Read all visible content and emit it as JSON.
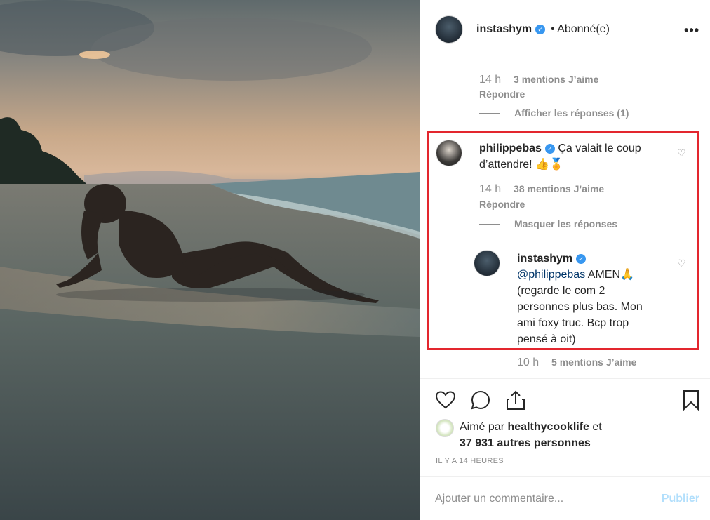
{
  "header": {
    "username": "instashym",
    "separator": "•",
    "follow_status": "Abonné(e)",
    "more_icon": "more-horizontal-icon"
  },
  "comments": [
    {
      "time": "14 h",
      "likes": "3 mentions J’aime",
      "reply": "Répondre",
      "toggle": "Afficher les réponses (1)"
    },
    {
      "username": "philippebas",
      "text_line1": "Ça valait le coup",
      "text_line2": "d’attendre! 👍🏅",
      "time": "14 h",
      "likes": "38 mentions J’aime",
      "reply": "Répondre",
      "toggle": "Masquer les réponses",
      "reply_comment": {
        "username": "instashym",
        "mention": "@philippebas",
        "text": " AMEN🙏",
        "lines": [
          "(regarde le com 2",
          "personnes plus bas. Mon",
          "ami foxy truc. Bcp trop",
          "pensé à oit)"
        ]
      }
    },
    {
      "time": "10 h",
      "likes": "5 mentions J’aime"
    }
  ],
  "liked_by": {
    "prefix": "Aimé par ",
    "user": "healthycooklife",
    "suffix": " et",
    "others": "37 931 autres personnes"
  },
  "timestamp": "IL Y A 14 HEURES",
  "add_comment": {
    "placeholder": "Ajouter un commentaire...",
    "post_label": "Publier"
  },
  "colors": {
    "highlight": "#e3262e",
    "verified": "#3897f0",
    "post_disabled": "#b2dffc"
  }
}
